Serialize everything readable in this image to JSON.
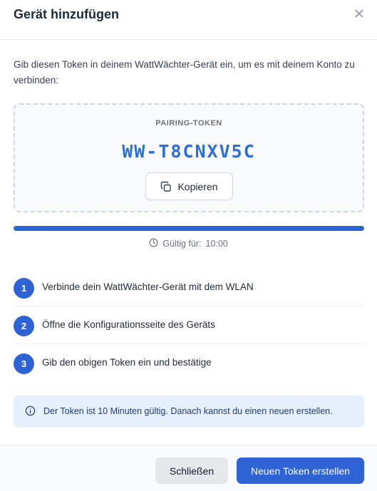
{
  "modal": {
    "title": "Gerät hinzufügen",
    "close_icon": "close-icon"
  },
  "intro": {
    "text": "Gib diesen Token in deinem WattWächter-Gerät ein, um es mit deinem Konto zu verbinden:"
  },
  "token": {
    "label": "PAIRING-TOKEN",
    "value": "WW-T8CNXV5C",
    "copy_label": "Kopieren",
    "copy_icon": "copy-icon"
  },
  "progress": {
    "fraction": 1.0,
    "validity_label": "Gültig für:",
    "validity_value": "10:00",
    "clock_icon": "clock-icon"
  },
  "steps": [
    {
      "number": "1",
      "text": "Verbinde dein WattWächter-Gerät mit dem WLAN"
    },
    {
      "number": "2",
      "text": "Öffne die Konfigurationsseite des Geräts"
    },
    {
      "number": "3",
      "text": "Gib den obigen Token ein und bestätige"
    }
  ],
  "info": {
    "icon": "info-icon",
    "text": "Der Token ist 10 Minuten gültig. Danach kannst du einen neuen erstellen."
  },
  "footer": {
    "close_label": "Schließen",
    "new_token_label": "Neuen Token erstellen"
  },
  "colors": {
    "accent": "#2e63d6",
    "token_text": "#2b6fd8",
    "info_background": "#e6effc"
  }
}
